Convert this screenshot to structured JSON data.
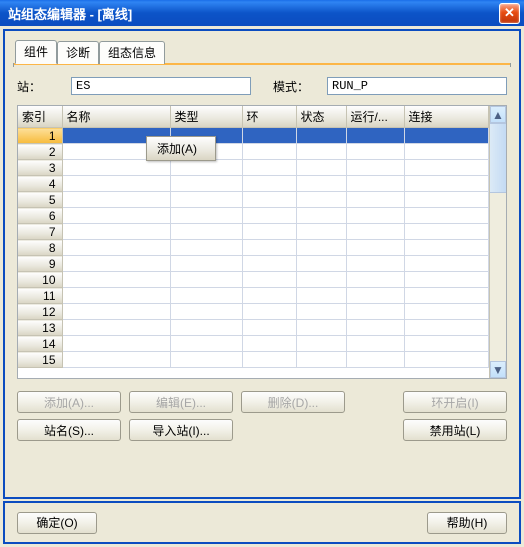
{
  "title": "站组态编辑器  -  [离线]",
  "close_glyph": "✕",
  "tabs": {
    "t0": "组件",
    "t1": "诊断",
    "t2": "组态信息"
  },
  "fields": {
    "station_label": "站：",
    "station_value": "ES",
    "mode_label": "模式：",
    "mode_value": "RUN_P"
  },
  "grid": {
    "headers": {
      "c0": "索引",
      "c1": "名称",
      "c2": "类型",
      "c3": "环",
      "c4": "状态",
      "c5": "运行/...",
      "c6": "连接"
    },
    "rows": [
      "1",
      "2",
      "3",
      "4",
      "5",
      "6",
      "7",
      "8",
      "9",
      "10",
      "11",
      "12",
      "13",
      "14",
      "15"
    ],
    "popup": "添加(A)"
  },
  "scroll": {
    "up": "▲",
    "down": "▼"
  },
  "buttons": {
    "add": "添加(A)...",
    "edit": "编辑(E)...",
    "delete": "删除(D)...",
    "ring_on": "环开启(I)",
    "station_name": "站名(S)...",
    "import": "导入站(I)...",
    "disable": "禁用站(L)"
  },
  "footer": {
    "ok": "确定(O)",
    "help": "帮助(H)"
  }
}
